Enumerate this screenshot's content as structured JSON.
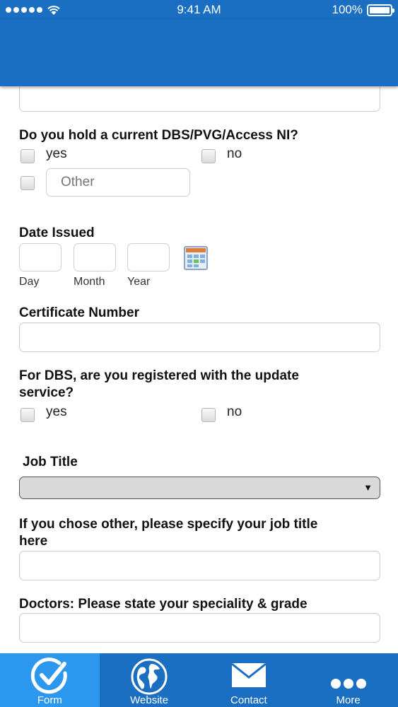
{
  "status_bar": {
    "time": "9:41 AM",
    "battery": "100%"
  },
  "form": {
    "dbs": {
      "question": "Do you hold a current DBS/PVG/Access NI?",
      "yes": "yes",
      "no": "no",
      "other_placeholder": "Other"
    },
    "date_issued": {
      "label": "Date Issued",
      "day": "Day",
      "month": "Month",
      "year": "Year"
    },
    "certificate_number": {
      "label": "Certificate Number"
    },
    "update_service": {
      "question_line1": "For DBS, are you registered with the update",
      "question_line2": "service?",
      "yes": "yes",
      "no": "no"
    },
    "job_title": {
      "label": "Job Title",
      "selected": ""
    },
    "job_title_other": {
      "label_line1": "If you chose other, please specify your job title",
      "label_line2": "here"
    },
    "doctors": {
      "label": "Doctors: Please state your speciality & grade"
    }
  },
  "tab_bar": {
    "tabs": [
      {
        "label": "Form",
        "icon": "checkmark-circle-icon",
        "active": true
      },
      {
        "label": "Website",
        "icon": "globe-icon",
        "active": false
      },
      {
        "label": "Contact",
        "icon": "envelope-icon",
        "active": false
      },
      {
        "label": "More",
        "icon": "more-dots-icon",
        "active": false
      }
    ]
  },
  "colors": {
    "primary": "#1a6fc2",
    "active_tab": "#2b97ee"
  }
}
